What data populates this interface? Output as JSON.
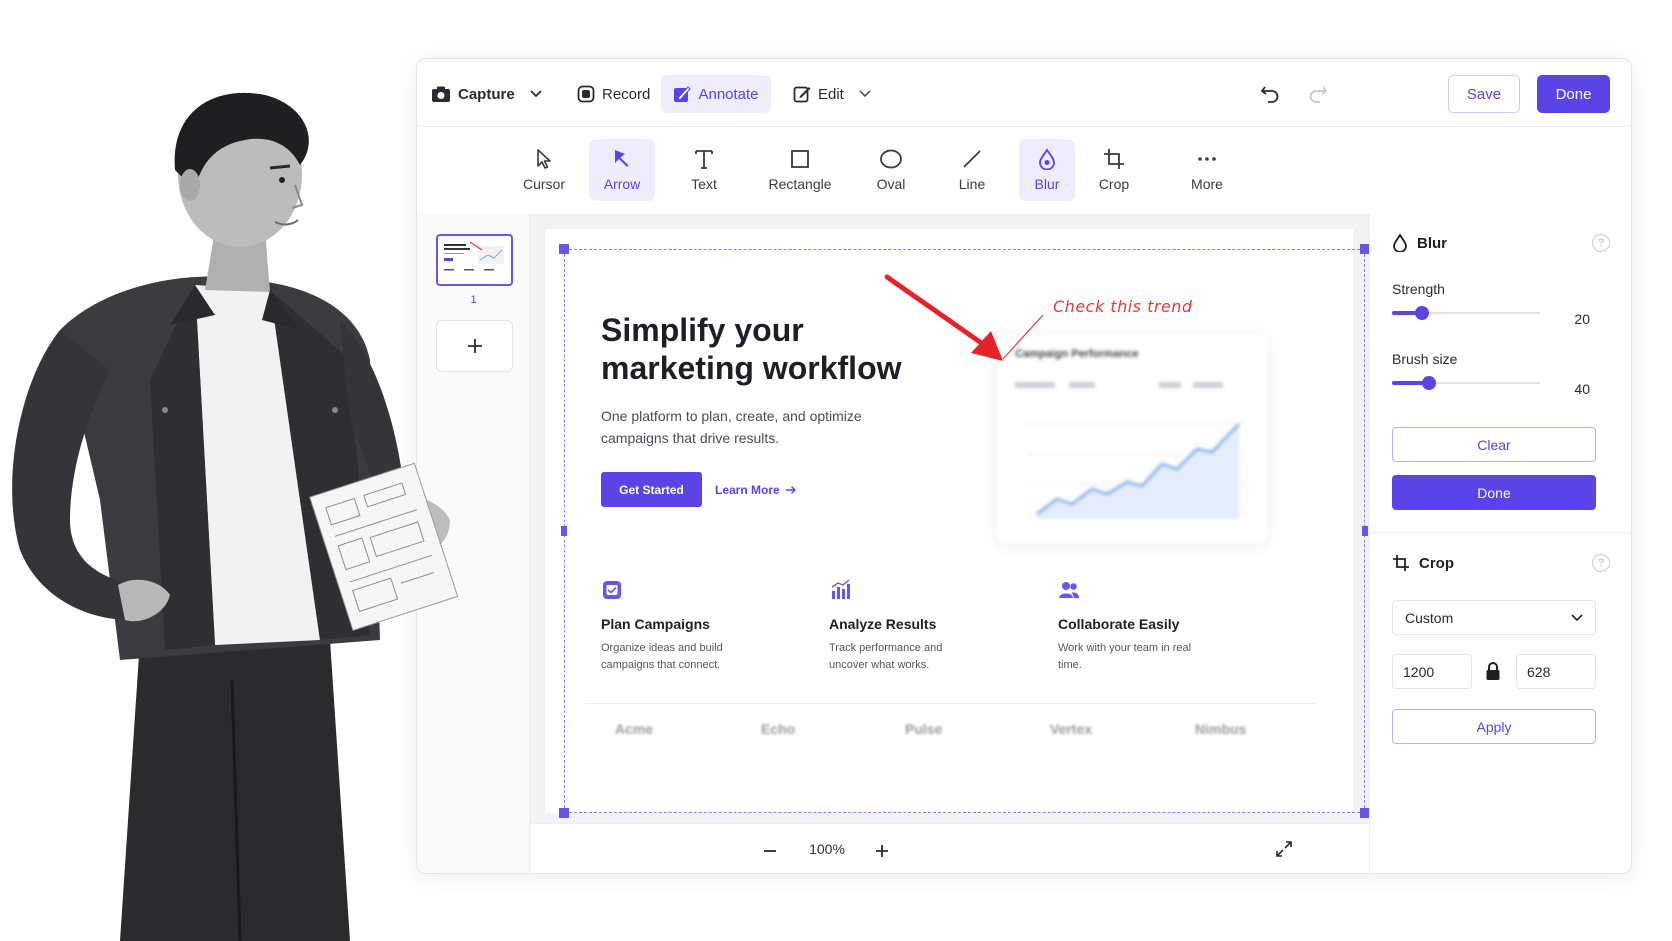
{
  "topbar": {
    "capture_label": "Capture",
    "record_label": "Record",
    "annotate_label": "Annotate",
    "edit_label": "Edit",
    "save_label": "Save",
    "done_label": "Done"
  },
  "tools": [
    {
      "label": "Cursor",
      "icon": "cursor-icon"
    },
    {
      "label": "Arrow",
      "icon": "arrow-tool-icon",
      "active": true
    },
    {
      "label": "Text",
      "icon": "text-icon"
    },
    {
      "label": "Rectangle",
      "icon": "rectangle-icon"
    },
    {
      "label": "Oval",
      "icon": "oval-icon"
    },
    {
      "label": "Line",
      "icon": "line-icon"
    },
    {
      "label": "Blur",
      "icon": "blur-drop-icon",
      "active": true
    },
    {
      "label": "Crop",
      "icon": "crop-icon"
    },
    {
      "label": "More",
      "icon": "more-dots-icon"
    }
  ],
  "thumbnails": {
    "page_number": "1"
  },
  "canvas": {
    "hero_title": "Simplify your marketing workflow",
    "hero_subtitle": "One platform to plan, create, and optimize campaigns that drive results.",
    "cta_primary": "Get Started",
    "cta_secondary": "Learn More",
    "annotation_text": "Check this trend",
    "chart_title": "Campaign Performance",
    "features": [
      {
        "title": "Plan Campaigns",
        "desc": "Organize ideas and build campaigns that connect.",
        "icon": "calendar-icon"
      },
      {
        "title": "Analyze Results",
        "desc": "Track performance and uncover what works.",
        "icon": "bar-chart-icon"
      },
      {
        "title": "Collaborate Easily",
        "desc": "Work with your team in real time.",
        "icon": "users-icon"
      }
    ],
    "logos": [
      "Acme",
      "Echo",
      "Pulse",
      "Vertex",
      "Nimbus"
    ]
  },
  "zoom": {
    "level": "100%"
  },
  "panel": {
    "blur": {
      "title": "Blur",
      "strength_label": "Strength",
      "strength_value": 20,
      "strength_fraction": 0.2,
      "brush_label": "Brush size",
      "brush_value": 40,
      "brush_fraction": 0.25,
      "clear_label": "Clear",
      "done_label": "Done"
    },
    "crop": {
      "title": "Crop",
      "preset": "Custom",
      "width": "1200",
      "height": "628",
      "apply_label": "Apply"
    }
  },
  "colors": {
    "accent": "#5b44e6",
    "annotation": "#e23a3a"
  }
}
